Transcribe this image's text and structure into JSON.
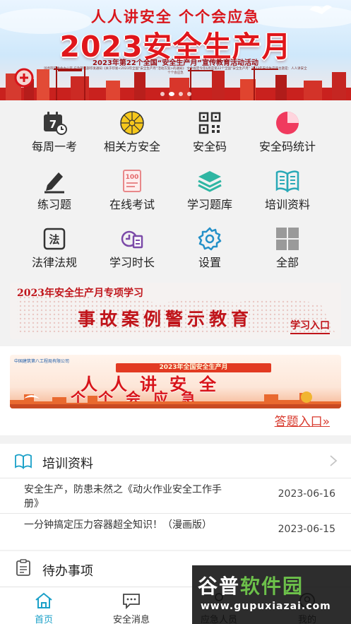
{
  "banner": {
    "slogan": "人人讲安全   个个会应急",
    "title": "2023安全生产月",
    "subtitle": "2023年第22个全国“安全生产月”宣传教育活动活动",
    "fine_print": "国务院安委会办公室 应急管理部印发通知《关于印发<2023年全国“安全生产月”活动方案>的通知》 文件规定今年6月是第22个全国“安全生产月” 2023年安全生产月主题是：人人讲安全 个个会应急",
    "slide_count": 4,
    "active_slide": 1
  },
  "grid": {
    "items": [
      {
        "label": "每周一考",
        "icon": "calendar-7-icon"
      },
      {
        "label": "相关方安全",
        "icon": "yellow-wheel-icon"
      },
      {
        "label": "安全码",
        "icon": "qr-code-icon"
      },
      {
        "label": "安全码统计",
        "icon": "pie-chart-icon"
      },
      {
        "label": "练习题",
        "icon": "pen-sign-icon"
      },
      {
        "label": "在线考试",
        "icon": "score-100-icon"
      },
      {
        "label": "学习题库",
        "icon": "layers-icon"
      },
      {
        "label": "培训资料",
        "icon": "open-book-icon"
      },
      {
        "label": "法律法规",
        "icon": "law-icon"
      },
      {
        "label": "学习时长",
        "icon": "clock-calendar-icon"
      },
      {
        "label": "设置",
        "icon": "gear-icon"
      },
      {
        "label": "全部",
        "icon": "all-grid-icon"
      }
    ]
  },
  "promo_study": {
    "title": "2023年安全生产月专项学习",
    "headline": "事故案例警示教育",
    "link": "学习入口"
  },
  "promo_quiz": {
    "company": "中国建筑第八工程局有限公司",
    "ribbon": "2023年全国安全生产月",
    "line1": "人人讲安全",
    "line2": "个个会应急",
    "link": "答题入口»"
  },
  "training": {
    "title": "培训资料",
    "items": [
      {
        "title": "安全生产，防患未然之《动火作业安全工作手册》",
        "date": "2023-06-16"
      },
      {
        "title": "一分钟搞定压力容器超全知识！（漫画版）",
        "date": "2023-06-15"
      }
    ]
  },
  "todo": {
    "title": "待办事项"
  },
  "nav": {
    "items": [
      {
        "label": "首页",
        "icon": "home-icon"
      },
      {
        "label": "安全消息",
        "icon": "message-icon"
      },
      {
        "label": "应急人员",
        "icon": "person-icon"
      },
      {
        "label": "我的",
        "icon": "profile-icon"
      }
    ],
    "active": 0
  },
  "watermark": {
    "line1": "谷普软件园",
    "line2": "www.gupuxiazai.com"
  },
  "colors": {
    "accent": "#1aa0c8",
    "brand_red": "#d8141a",
    "link_red": "#d83a2e"
  }
}
